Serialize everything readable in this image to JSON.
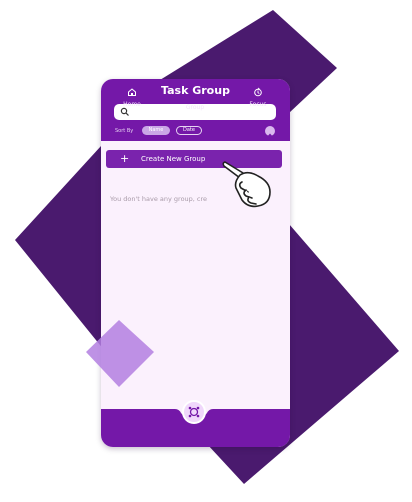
{
  "app": {
    "title": "Task Group"
  },
  "search": {
    "placeholder": "",
    "value": ""
  },
  "sort": {
    "label": "Sort By",
    "options": [
      "Name",
      "Date"
    ],
    "selected": "Name"
  },
  "actions": {
    "create_label": "Create New Group",
    "plus_icon": "+"
  },
  "empty_state": {
    "message": "You don't have any group, cre"
  },
  "nav": {
    "items": [
      {
        "label": "Home",
        "icon": "home-icon"
      },
      {
        "label": "Group",
        "icon": "group-icon"
      },
      {
        "label": "Focus",
        "icon": "focus-icon"
      }
    ],
    "active": "Group"
  },
  "colors": {
    "primary": "#7418a8",
    "dark_shape": "#4a1a6e",
    "light_shape": "#b37fe0",
    "background": "#fbf1fd"
  }
}
